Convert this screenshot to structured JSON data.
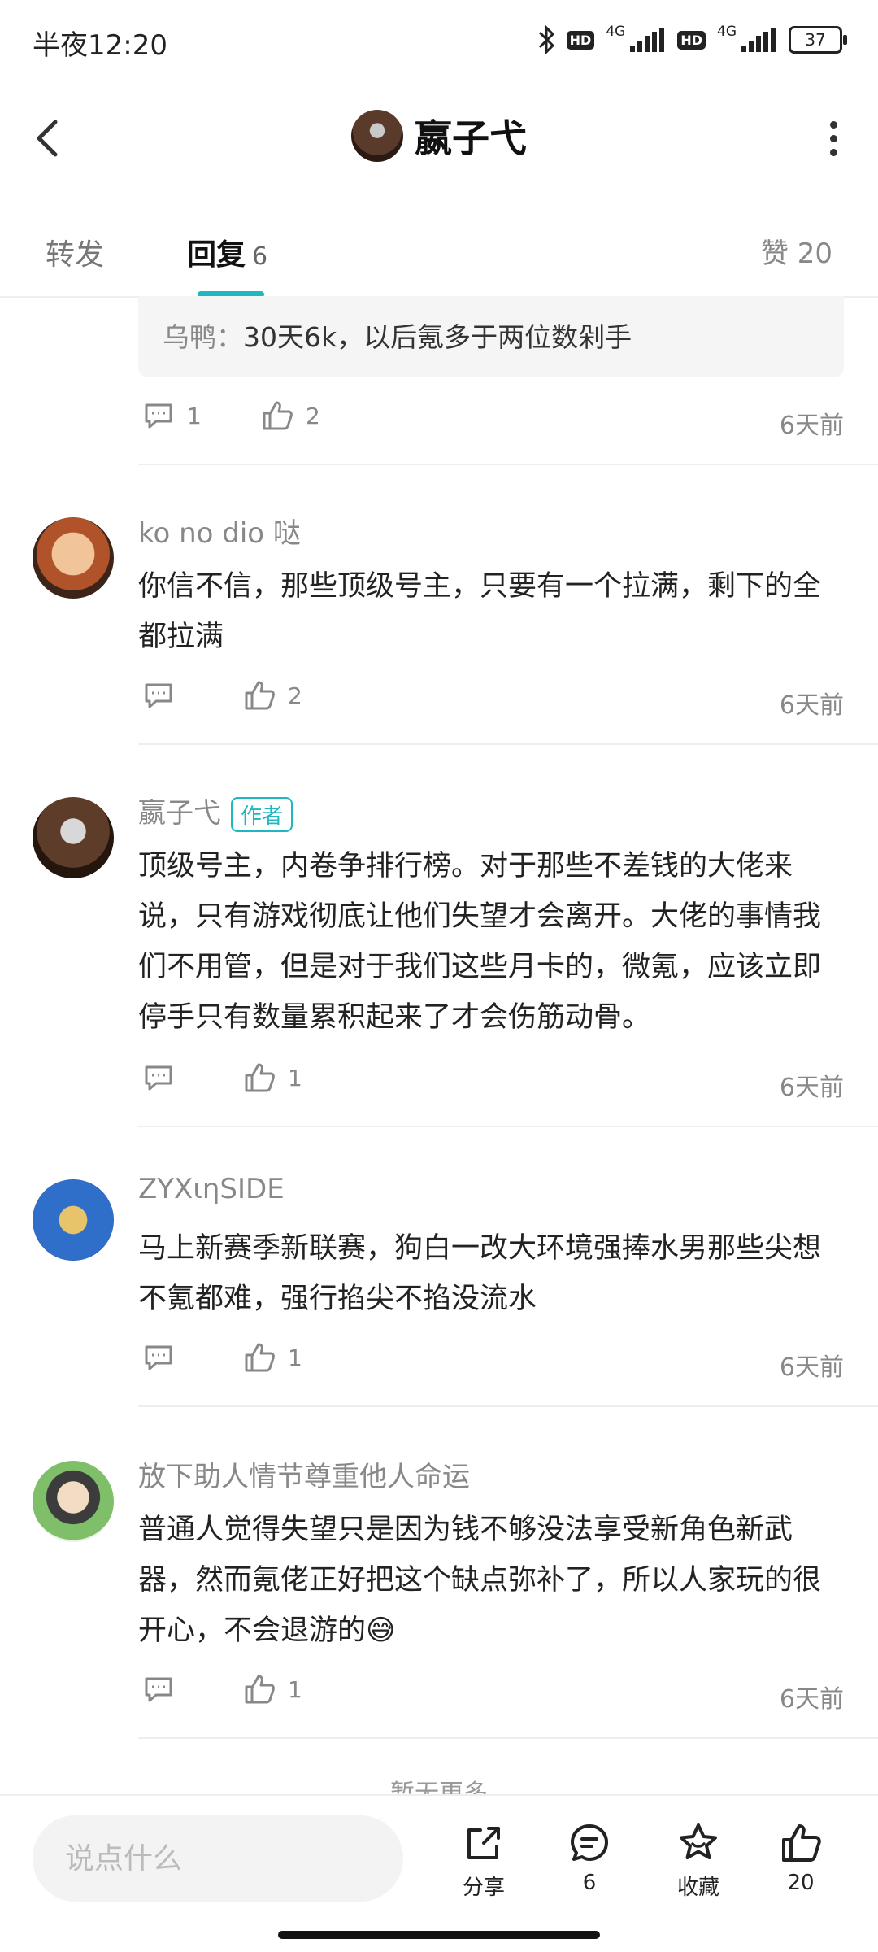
{
  "status_bar": {
    "time": "半夜12:20",
    "hd": "HD",
    "net": "4G",
    "battery": "37"
  },
  "header": {
    "title": "嬴子弋"
  },
  "tabs": {
    "repost": "转发",
    "reply": "回复",
    "reply_count": "6",
    "likes": "赞 20"
  },
  "quote": {
    "author": "乌鸭",
    "separator": "：",
    "text": "30天6k，以后氪多于两位数剁手"
  },
  "quote_actions": {
    "reply_count": "1",
    "like_count": "2",
    "time": "6天前"
  },
  "comments": [
    {
      "user": "ko no dio 哒",
      "text": "你信不信，那些顶级号主，只要有一个拉满，剩下的全都拉满",
      "reply_count": "",
      "like_count": "2",
      "time": "6天前"
    },
    {
      "user": "嬴子弋",
      "badge": "作者",
      "text": "顶级号主，内卷争排行榜。对于那些不差钱的大佬来说，只有游戏彻底让他们失望才会离开。大佬的事情我们不用管，但是对于我们这些月卡的，微氪，应该立即停手只有数量累积起来了才会伤筋动骨。",
      "reply_count": "",
      "like_count": "1",
      "time": "6天前"
    },
    {
      "user": "ZYXιηSIDE",
      "text": "马上新赛季新联赛，狗白一改大环境强捧水男那些尖想不氪都难，强行掐尖不掐没流水",
      "reply_count": "",
      "like_count": "1",
      "time": "6天前"
    },
    {
      "user": "放下助人情节尊重他人命运",
      "text": "普通人觉得失望只是因为钱不够没法享受新角色新武器，然而氪佬正好把这个缺点弥补了，所以人家玩的很开心，不会退游的😅",
      "reply_count": "",
      "like_count": "1",
      "time": "6天前"
    }
  ],
  "more_hint": "暂无更多",
  "bottom_bar": {
    "input_placeholder": "说点什么",
    "share_label": "分享",
    "comment_count": "6",
    "favorite_label": "收藏",
    "like_count": "20"
  },
  "colors": {
    "accent": "#1fb8c0",
    "muted_text": "#888888",
    "divider": "#eeeeee",
    "quote_bg": "#f5f5f5"
  }
}
